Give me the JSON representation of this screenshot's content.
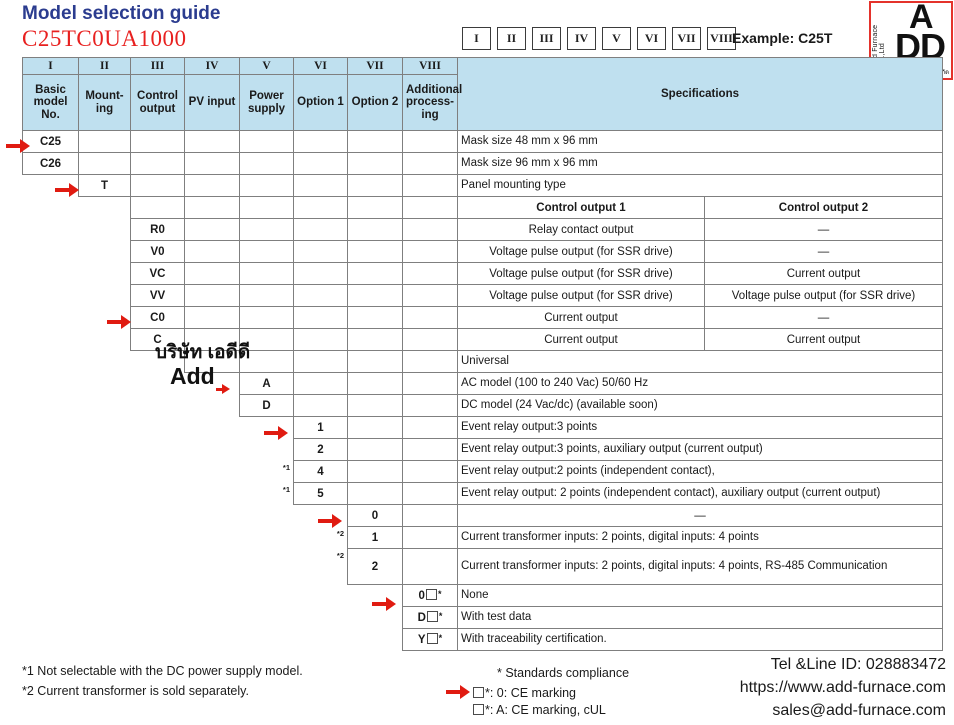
{
  "header": {
    "title": "Model selection guide",
    "model_code": "C25TC0UA1000",
    "roman_boxes": [
      "I",
      "II",
      "III",
      "IV",
      "V",
      "VI",
      "VII",
      "VIII"
    ],
    "example": "Example: C25T"
  },
  "logo": {
    "vertical_text": "Add Furnace Co.,Ltd",
    "letter_top": "A",
    "letter_bottom": "DD",
    "thai_text": "บริษัท เอดีดี เฟอร์เนซ จำกัด",
    "border_color": "#e4322b"
  },
  "watermark": {
    "thai": "บริษัท เอดีดี",
    "latin": "Add"
  },
  "table": {
    "roman_headers": [
      "I",
      "II",
      "III",
      "IV",
      "V",
      "VI",
      "VII",
      "VIII"
    ],
    "column_headers": [
      "Basic model No.",
      "Mount-ing",
      "Control output",
      "PV input",
      "Power supply",
      "Option 1",
      "Option 2",
      "Additional process-ing"
    ],
    "spec_header": "Specifications",
    "control_output_1": "Control output 1",
    "control_output_2": "Control output 2",
    "rows": [
      {
        "col": 0,
        "code": "C25",
        "spec": "Mask size 48 mm x 96 mm",
        "arrow": true
      },
      {
        "col": 0,
        "code": "C26",
        "spec": "Mask size 96 mm x 96 mm",
        "arrow": false
      },
      {
        "col": 1,
        "code": "T",
        "spec": "Panel mounting type",
        "arrow": true
      },
      {
        "col": 2,
        "code": "",
        "spec2a": "Control output 1",
        "spec2b": "Control output 2",
        "arrow": false,
        "subhead": true
      },
      {
        "col": 2,
        "code": "R0",
        "spec2a": "Relay contact output",
        "spec2b": "—",
        "arrow": false
      },
      {
        "col": 2,
        "code": "V0",
        "spec2a": "Voltage pulse output (for SSR drive)",
        "spec2b": "—",
        "arrow": false
      },
      {
        "col": 2,
        "code": "VC",
        "spec2a": "Voltage pulse output (for SSR drive)",
        "spec2b": "Current output",
        "arrow": false
      },
      {
        "col": 2,
        "code": "VV",
        "spec2a": "Voltage pulse output (for SSR drive)",
        "spec2b": "Voltage pulse output (for SSR drive)",
        "arrow": false
      },
      {
        "col": 2,
        "code": "C0",
        "spec2a": "Current output",
        "spec2b": "—",
        "arrow": true
      },
      {
        "col": 2,
        "code": "C",
        "spec2a": "Current output",
        "spec2b": "Current output",
        "arrow": false
      },
      {
        "col": 3,
        "code": "",
        "spec": "Universal",
        "arrow": false
      },
      {
        "col": 4,
        "code": "A",
        "spec": "AC model (100 to 240 Vac) 50/60 Hz",
        "arrow": true
      },
      {
        "col": 4,
        "code": "D",
        "spec": "DC model (24 Vac/dc) (available soon)",
        "arrow": false
      },
      {
        "col": 5,
        "code": "1",
        "spec": "Event relay output:3 points",
        "arrow": true,
        "note": ""
      },
      {
        "col": 5,
        "code": "2",
        "spec": "Event relay output:3 points, auxiliary output (current output)",
        "arrow": false,
        "note": ""
      },
      {
        "col": 5,
        "code": "4",
        "spec": "Event relay output:2 points (independent contact),",
        "arrow": false,
        "note": "*1"
      },
      {
        "col": 5,
        "code": "5",
        "spec": "Event relay output:   2 points (independent contact), auxiliary output (current output)",
        "arrow": false,
        "note": "*1"
      },
      {
        "col": 6,
        "code": "0",
        "spec": "—",
        "arrow": true,
        "note": ""
      },
      {
        "col": 6,
        "code": "1",
        "spec": "Current transformer inputs: 2 points, digital inputs: 4 points",
        "arrow": false,
        "note": "*2"
      },
      {
        "col": 6,
        "code": "2",
        "spec": "Current transformer inputs: 2 points, digital inputs: 4 points, RS-485 Communication",
        "arrow": false,
        "note": "*2"
      },
      {
        "col": 7,
        "code": "0",
        "spec": "None",
        "arrow": true,
        "checkbox": true,
        "star": "*"
      },
      {
        "col": 7,
        "code": "D",
        "spec": "With test data",
        "arrow": false,
        "checkbox": true,
        "star": "*"
      },
      {
        "col": 7,
        "code": "Y",
        "spec": "With traceability certification.",
        "arrow": false,
        "checkbox": true,
        "star": "*"
      }
    ]
  },
  "footnotes": {
    "note1": "*1  Not selectable with the DC power supply model.",
    "note2": "*2  Current transformer is sold separately.",
    "standards_title": "* Standards compliance",
    "standard_1": "*: 0: CE marking",
    "standard_2": "*: A: CE marking, cUL"
  },
  "contact": {
    "tel": "Tel &Line ID: 028883472",
    "website": "https://www.add-furnace.com",
    "email": "sales@add-furnace.com"
  },
  "colors": {
    "title_blue": "#2b3c8f",
    "model_red": "#e8201f",
    "header_fill": "#bfe0ef",
    "arrow_red": "#e01b11"
  }
}
